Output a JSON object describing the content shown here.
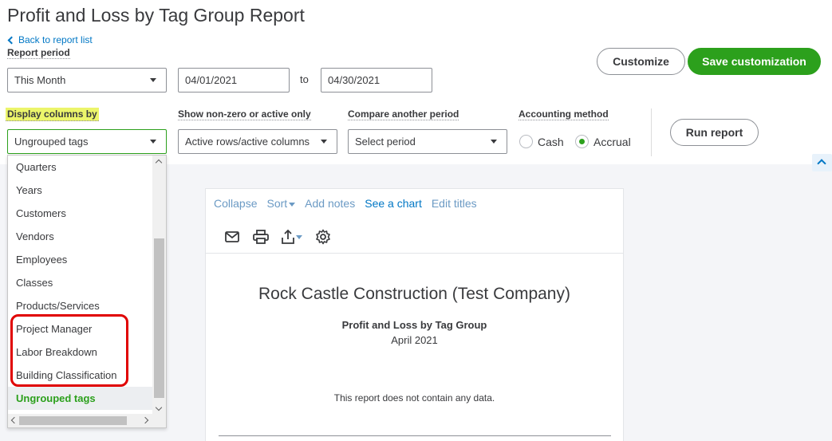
{
  "page": {
    "title": "Profit and Loss by Tag Group Report",
    "back_label": "Back to report list"
  },
  "report_period": {
    "label": "Report period",
    "value": "This Month",
    "from": "04/01/2021",
    "to_label": "to",
    "to": "04/30/2021"
  },
  "actions": {
    "customize": "Customize",
    "save": "Save customization",
    "run": "Run report"
  },
  "display_columns": {
    "label": "Display columns by",
    "value": "Ungrouped tags",
    "options": [
      "Quarters",
      "Years",
      "Customers",
      "Vendors",
      "Employees",
      "Classes",
      "Products/Services",
      "Project Manager",
      "Labor Breakdown",
      "Building Classification",
      "Ungrouped tags"
    ],
    "selected_index": 10
  },
  "nonzero": {
    "label": "Show non-zero or active only",
    "value": "Active rows/active columns"
  },
  "compare": {
    "label": "Compare another period",
    "value": "Select period"
  },
  "accounting": {
    "label": "Accounting method",
    "cash": "Cash",
    "accrual": "Accrual",
    "selected": "Accrual"
  },
  "report": {
    "toolbar": {
      "collapse": "Collapse",
      "sort": "Sort",
      "add_notes": "Add notes",
      "see_chart": "See a chart",
      "edit_titles": "Edit titles"
    },
    "icons": [
      "email-icon",
      "print-icon",
      "export-icon",
      "gear-icon"
    ],
    "company": "Rock Castle Construction (Test Company)",
    "title": "Profit and Loss by Tag Group",
    "period": "April 2021",
    "empty_message": "This report does not contain any data."
  },
  "colors": {
    "accent_green": "#2ca01c",
    "link_blue": "#0077c5",
    "highlight_yellow": "#ecf56b",
    "annotation_red": "#e00000"
  }
}
